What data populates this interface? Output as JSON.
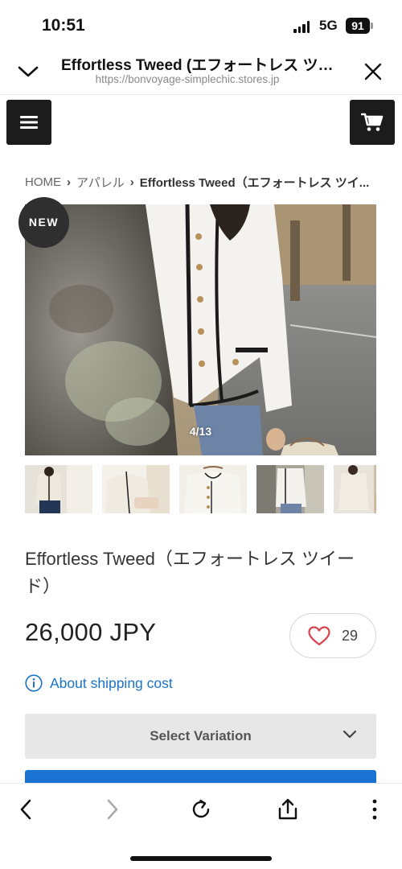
{
  "status_bar": {
    "time": "10:51",
    "network": "5G",
    "battery": "91"
  },
  "browser": {
    "title": "Effortless Tweed (エフォートレス ツ…",
    "url": "https://bonvoyage-simplechic.stores.jp"
  },
  "breadcrumb": {
    "home": "HOME",
    "category": "アパレル",
    "current": "Effortless Tweed（エフォートレス ツイ..."
  },
  "gallery": {
    "badge": "NEW",
    "counter": "4/13",
    "current_index": 4,
    "total": 13
  },
  "product": {
    "title": "Effortless Tweed（エフォートレス ツイード）",
    "price": "26,000 JPY",
    "likes": "29",
    "shipping_link": "About shipping cost",
    "variation_placeholder": "Select Variation"
  },
  "colors": {
    "accent_blue": "#1a73c7",
    "heart_red": "#d9434e",
    "nav_black": "#1c1c1c"
  },
  "icons": {
    "menu": "menu-icon",
    "cart": "cart-icon",
    "info": "info-icon",
    "heart": "heart-icon",
    "back": "back-icon",
    "forward": "forward-icon",
    "reload": "reload-icon",
    "share": "share-icon",
    "more": "more-icon"
  }
}
